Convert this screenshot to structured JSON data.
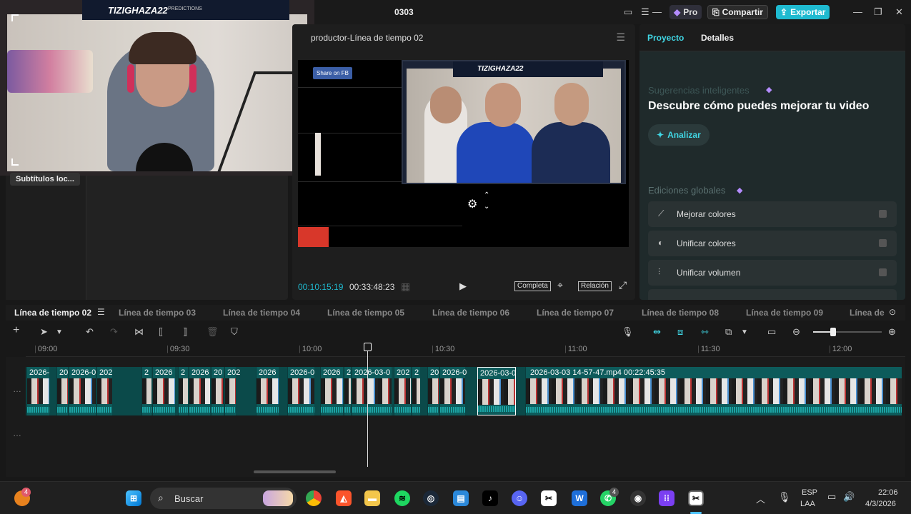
{
  "window": {
    "title": "0303",
    "pro_label": "Pro",
    "share_label": "Compartir",
    "export_label": "Exportar"
  },
  "webcam": {
    "channel_name": "TIZIGHAZA22",
    "sub_label": "PREDICTIONS"
  },
  "media": {
    "subtitles_chip": "Subtítulos loc..."
  },
  "player": {
    "title": "productor-Línea de tiempo 02",
    "fb_button": "Share on FB",
    "inner_banner": "TIZIGHAZA22",
    "current_time": "00:10:15:19",
    "total_time": "00:33:48:23",
    "full_label": "Completa",
    "ratio_label": "Relación"
  },
  "right_panel": {
    "tabs": [
      "Proyecto",
      "Detalles"
    ],
    "suggestions_title": "Sugerencias inteligentes",
    "discover_text": "Descubre cómo puedes mejorar tu video",
    "analyze_label": "Analizar",
    "global_title": "Ediciones globales",
    "global_items": [
      {
        "label": "Mejorar colores",
        "icon": "magic-wand-icon"
      },
      {
        "label": "Unificar colores",
        "icon": "color-match-icon"
      },
      {
        "label": "Unificar volumen",
        "icon": "volume-sliders-icon"
      }
    ]
  },
  "timeline": {
    "tabs": [
      "Línea de tiempo 02",
      "Línea de tiempo 03",
      "Línea de tiempo 04",
      "Línea de tiempo 05",
      "Línea de tiempo 06",
      "Línea de tiempo 07",
      "Línea de tiempo 08",
      "Línea de tiempo 09",
      "Línea de"
    ],
    "ruler": [
      "09:00",
      "09:30",
      "10:00",
      "10:30",
      "11:00",
      "11:30",
      "12:00"
    ],
    "clips": [
      {
        "label": "2026-"
      },
      {
        "label": "20"
      },
      {
        "label": "2026-0"
      },
      {
        "label": "202"
      },
      {
        "label": "2"
      },
      {
        "label": "2026"
      },
      {
        "label": "2"
      },
      {
        "label": "2026"
      },
      {
        "label": "20"
      },
      {
        "label": "202"
      },
      {
        "label": "2026"
      },
      {
        "label": "2026-0"
      },
      {
        "label": "2026"
      },
      {
        "label": "2"
      },
      {
        "label": "2026-03-0"
      },
      {
        "label": "202"
      },
      {
        "label": "2"
      },
      {
        "label": "20"
      },
      {
        "label": "2026-0"
      },
      {
        "label": "2026-03-0"
      },
      {
        "label": "2026-03-03 14-57-47.mp4   00:22:45:35"
      }
    ]
  },
  "taskbar": {
    "search_label": "Buscar",
    "language": "ESP",
    "layout": "LAA",
    "time": "22:06",
    "date": "4/3/2026",
    "notif_badge": "4",
    "whatsapp_badge": "4"
  }
}
